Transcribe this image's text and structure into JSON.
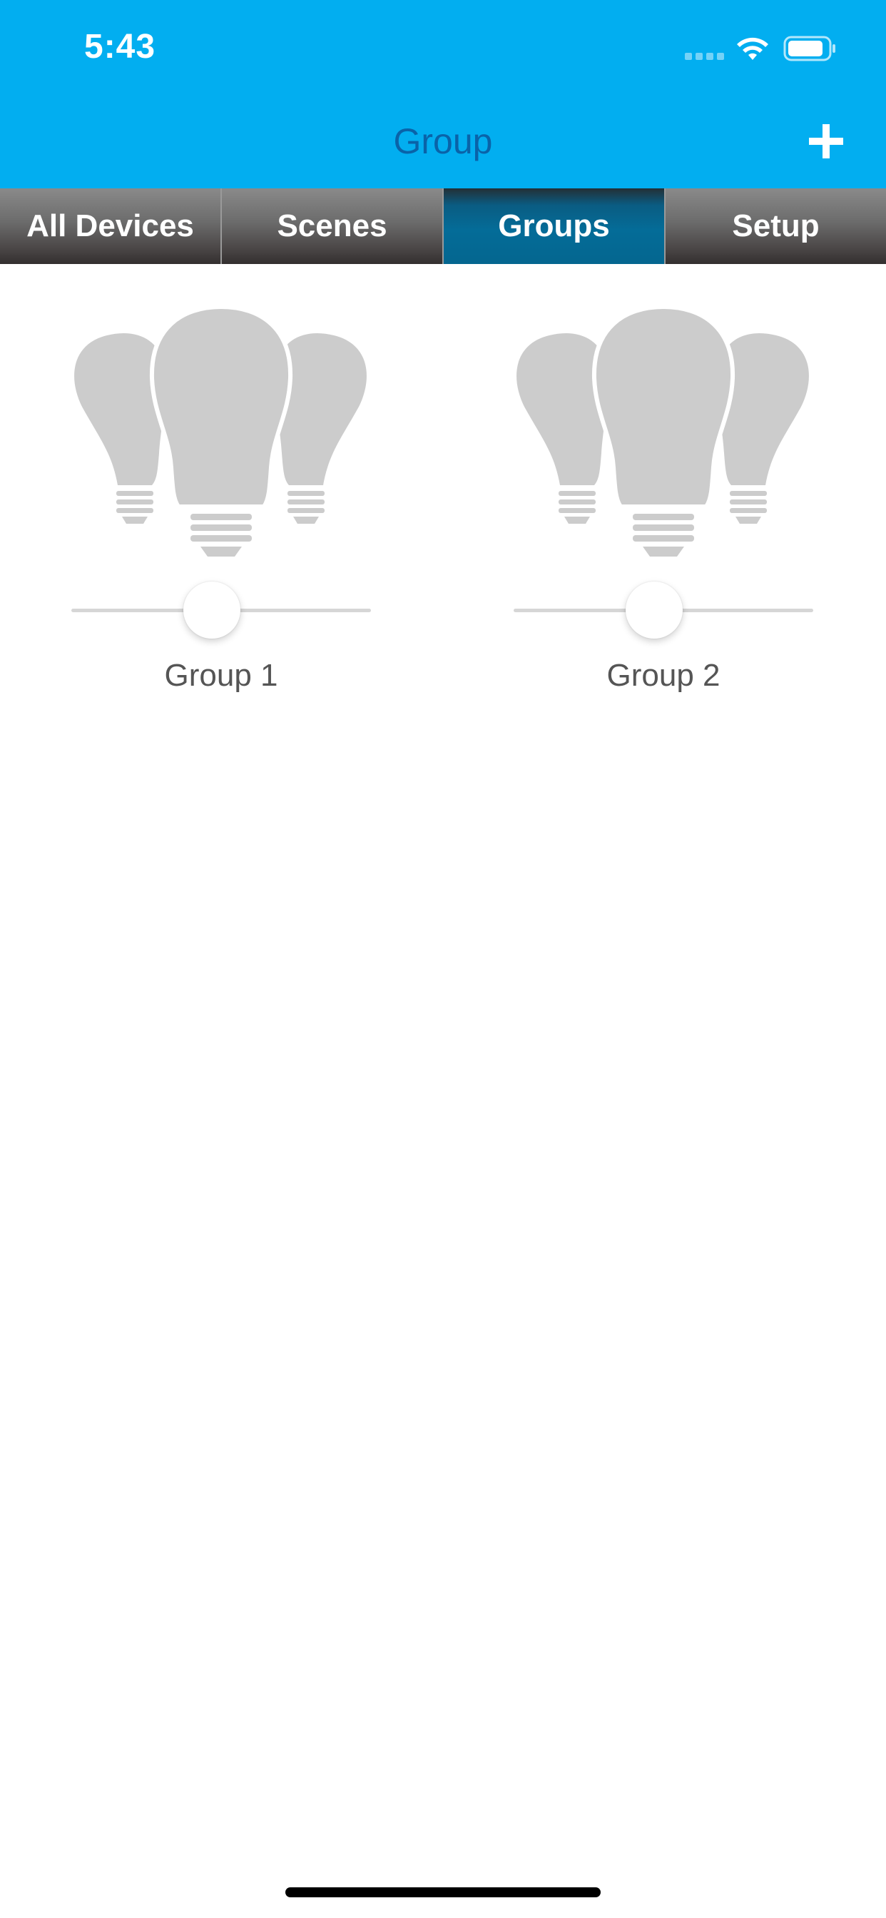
{
  "status_bar": {
    "time": "5:43"
  },
  "nav": {
    "title": "Group",
    "add_icon": "plus-icon"
  },
  "tabs": [
    {
      "label": "All Devices",
      "active": false
    },
    {
      "label": "Scenes",
      "active": false
    },
    {
      "label": "Groups",
      "active": true
    },
    {
      "label": "Setup",
      "active": false
    }
  ],
  "groups": [
    {
      "name": "Group 1",
      "icon": "bulb-group-icon",
      "slider_value": 0.47
    },
    {
      "name": "Group 2",
      "icon": "bulb-group-icon",
      "slider_value": 0.47
    }
  ],
  "colors": {
    "header": "#02aef0",
    "title": "#0a63a8",
    "active_tab": "#046c98",
    "bulb": "#cccccc"
  }
}
